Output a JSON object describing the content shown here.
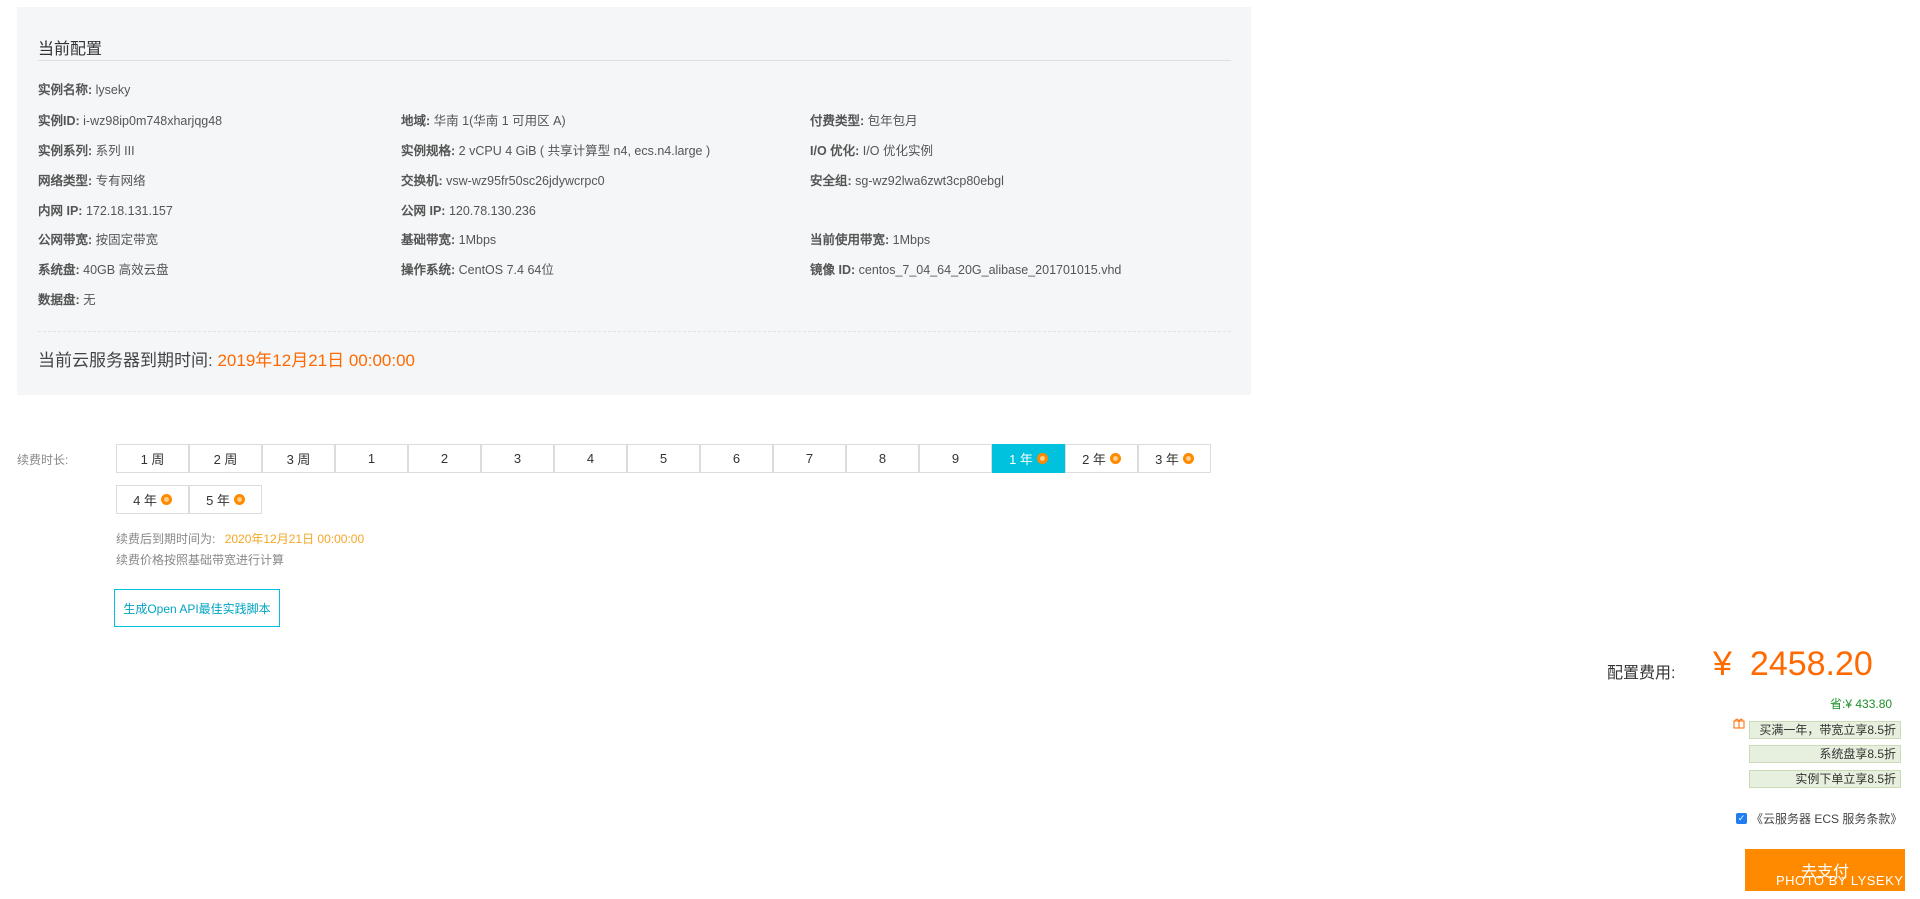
{
  "config": {
    "title": "当前配置",
    "rows": {
      "instance_name": {
        "key": "实例名称:",
        "value": "lyseky"
      },
      "instance_id": {
        "key": "实例ID:",
        "value": "i-wz98ip0m748xharjqg48"
      },
      "region": {
        "key": "地域:",
        "value": "华南 1(华南 1 可用区 A)"
      },
      "billing": {
        "key": "付费类型:",
        "value": "包年包月"
      },
      "series": {
        "key": "实例系列:",
        "value": "系列 III"
      },
      "spec": {
        "key": "实例规格:",
        "value": "2 vCPU 4 GiB ( 共享计算型 n4, ecs.n4.large )"
      },
      "io": {
        "key": "I/O 优化:",
        "value": "I/O 优化实例"
      },
      "network_type": {
        "key": "网络类型:",
        "value": "专有网络"
      },
      "switch": {
        "key": "交换机:",
        "value": "vsw-wz95fr50sc26jdywcrpc0"
      },
      "security_group": {
        "key": "安全组:",
        "value": "sg-wz92lwa6zwt3cp80ebgl"
      },
      "private_ip": {
        "key": "内网 IP:",
        "value": "172.18.131.157"
      },
      "public_ip": {
        "key": "公网 IP:",
        "value": "120.78.130.236"
      },
      "public_bw": {
        "key": "公网带宽:",
        "value": "按固定带宽"
      },
      "base_bw": {
        "key": "基础带宽:",
        "value": "1Mbps"
      },
      "current_bw": {
        "key": "当前使用带宽:",
        "value": "1Mbps"
      },
      "system_disk": {
        "key": "系统盘:",
        "value": "40GB 高效云盘"
      },
      "os": {
        "key": "操作系统:",
        "value": "CentOS 7.4 64位"
      },
      "image_id": {
        "key": "镜像 ID:",
        "value": "centos_7_04_64_20G_alibase_201701015.vhd"
      },
      "data_disk": {
        "key": "数据盘:",
        "value": "无"
      }
    },
    "expire_label": "当前云服务器到期时间:",
    "expire_value": "2019年12月21日 00:00:00"
  },
  "renew": {
    "label": "续费时长:",
    "options": [
      {
        "label": "1 周",
        "promo": false,
        "selected": false
      },
      {
        "label": "2 周",
        "promo": false,
        "selected": false
      },
      {
        "label": "3 周",
        "promo": false,
        "selected": false
      },
      {
        "label": "1",
        "promo": false,
        "selected": false
      },
      {
        "label": "2",
        "promo": false,
        "selected": false
      },
      {
        "label": "3",
        "promo": false,
        "selected": false
      },
      {
        "label": "4",
        "promo": false,
        "selected": false
      },
      {
        "label": "5",
        "promo": false,
        "selected": false
      },
      {
        "label": "6",
        "promo": false,
        "selected": false
      },
      {
        "label": "7",
        "promo": false,
        "selected": false
      },
      {
        "label": "8",
        "promo": false,
        "selected": false
      },
      {
        "label": "9",
        "promo": false,
        "selected": false
      },
      {
        "label": "1 年",
        "promo": true,
        "selected": true
      },
      {
        "label": "2 年",
        "promo": true,
        "selected": false
      },
      {
        "label": "3 年",
        "promo": true,
        "selected": false
      },
      {
        "label": "4 年",
        "promo": true,
        "selected": false
      },
      {
        "label": "5 年",
        "promo": true,
        "selected": false
      }
    ],
    "after_label": "续费后到期时间为:",
    "after_value": "2020年12月21日 00:00:00",
    "note": "续费价格按照基础带宽进行计算",
    "api_button": "生成Open API最佳实践脚本"
  },
  "price": {
    "fee_label": "配置费用:",
    "currency": "¥",
    "amount": "2458.20",
    "save": "省:¥ 433.80",
    "promos": [
      "买满一年，带宽立享8.5折",
      "系统盘享8.5折",
      "实例下单立享8.5折"
    ],
    "agreement": "《云服务器 ECS 服务条款》",
    "agreement_checked": true,
    "pay_button": "去支付",
    "watermark": "PHOTO BY LYSEKY"
  },
  "colors": {
    "accent": "#00c1de",
    "price": "#ff6a00",
    "pay": "#ff8a00",
    "renew_date": "#f5a623",
    "save": "#1a8f2a"
  }
}
